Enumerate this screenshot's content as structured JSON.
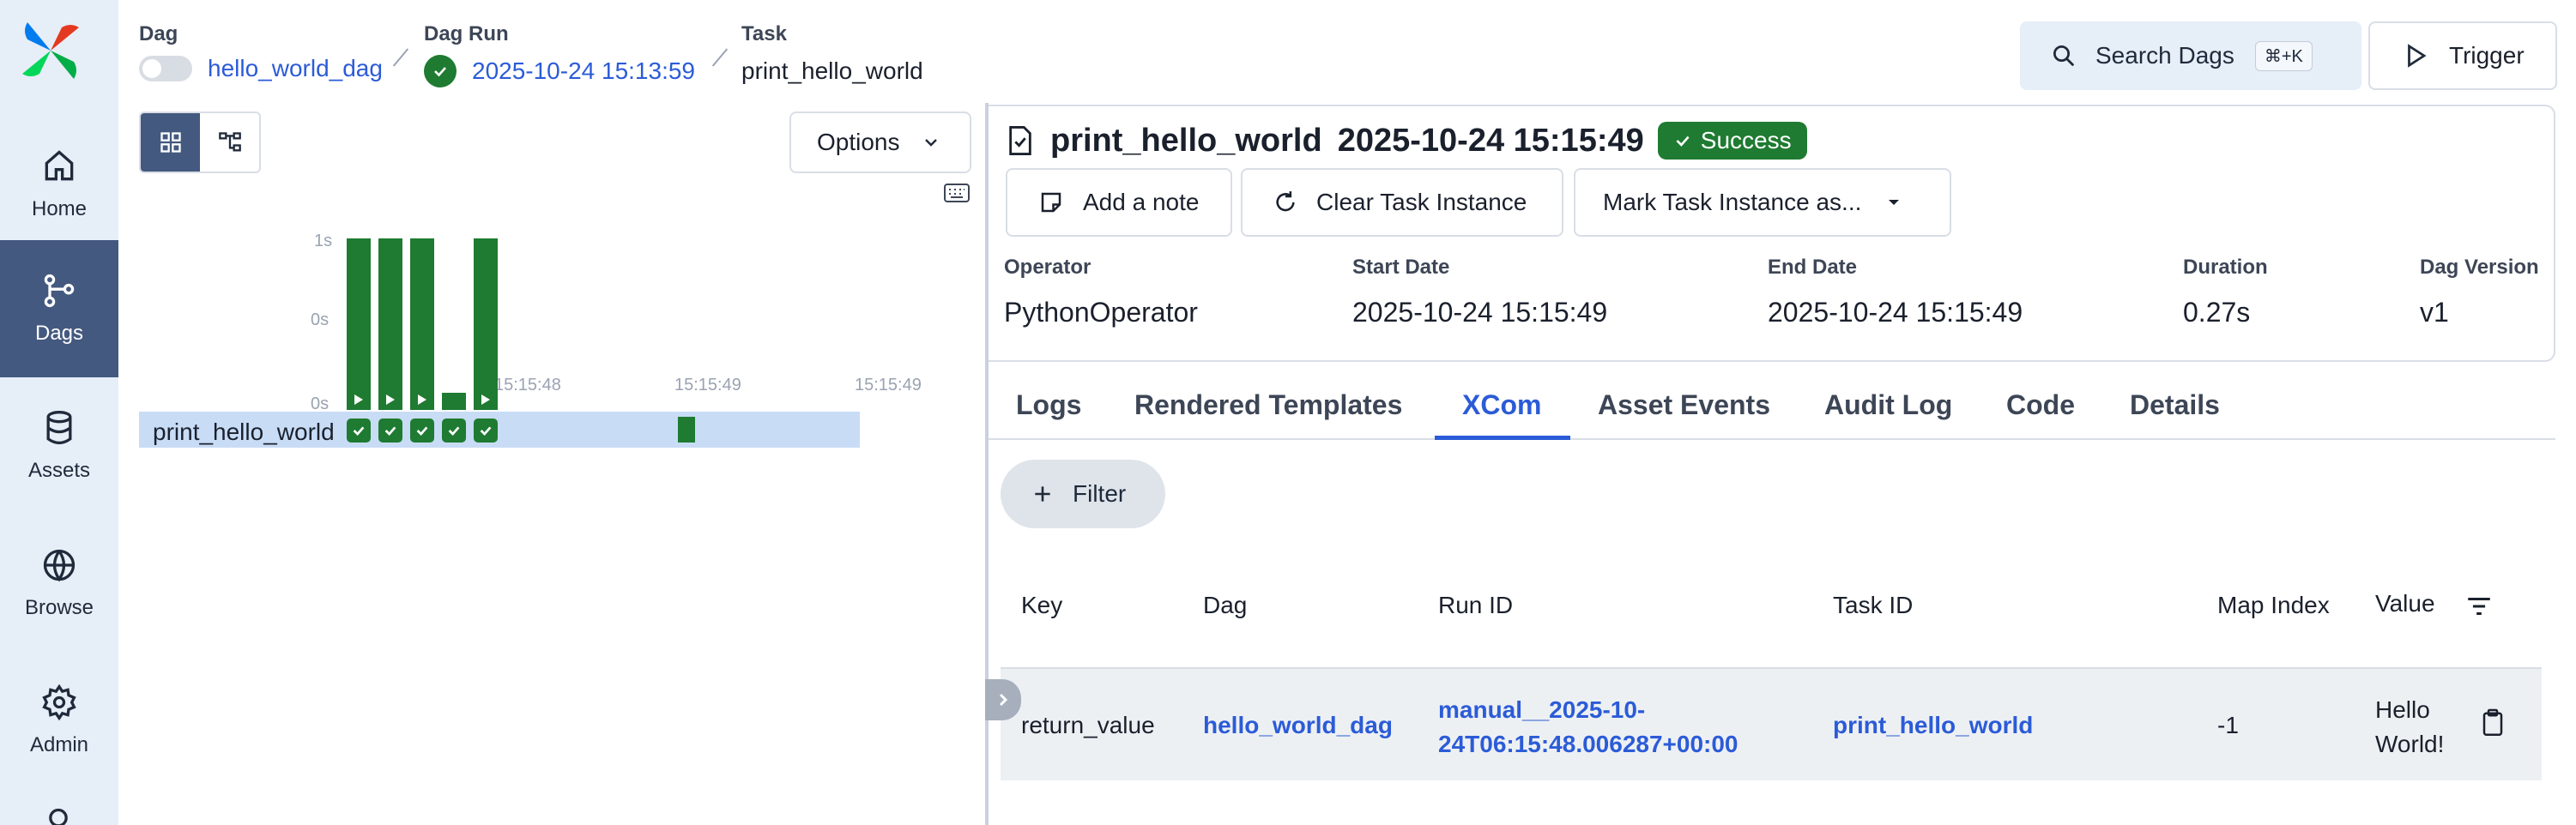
{
  "nav": {
    "items": [
      {
        "label": "Home",
        "icon": "home-icon"
      },
      {
        "label": "Dags",
        "icon": "dags-icon"
      },
      {
        "label": "Assets",
        "icon": "database-icon"
      },
      {
        "label": "Browse",
        "icon": "globe-icon"
      },
      {
        "label": "Admin",
        "icon": "gear-icon"
      }
    ],
    "active": "Dags"
  },
  "breadcrumb": {
    "dag_label": "Dag",
    "dag_value": "hello_world_dag",
    "run_label": "Dag Run",
    "run_value": "2025-10-24 15:13:59",
    "task_label": "Task",
    "task_value": "print_hello_world"
  },
  "header": {
    "search_label": "Search Dags",
    "search_shortcut": "⌘+K",
    "trigger_label": "Trigger"
  },
  "grid": {
    "options_label": "Options",
    "y_ticks": [
      "1s",
      "0s",
      "0s"
    ],
    "x_ticks": [
      "15:15:48",
      "15:15:49",
      "15:15:49"
    ],
    "task_name": "print_hello_world",
    "run_durations": [
      1.0,
      1.0,
      1.0,
      0.1,
      1.0
    ],
    "colors": {
      "success": "#1e7b31",
      "selected_row": "#c8dcf6"
    }
  },
  "task_instance": {
    "title": "print_hello_world",
    "timestamp": "2025-10-24 15:15:49",
    "state": "Success",
    "actions": {
      "add_note": "Add a note",
      "clear": "Clear Task Instance",
      "mark": "Mark Task Instance as..."
    },
    "details": [
      {
        "label": "Operator",
        "value": "PythonOperator"
      },
      {
        "label": "Start Date",
        "value": "2025-10-24 15:15:49"
      },
      {
        "label": "End Date",
        "value": "2025-10-24 15:15:49"
      },
      {
        "label": "Duration",
        "value": "0.27s"
      },
      {
        "label": "Dag Version",
        "value": "v1"
      }
    ]
  },
  "tabs": {
    "items": [
      "Logs",
      "Rendered Templates",
      "XCom",
      "Asset Events",
      "Audit Log",
      "Code",
      "Details"
    ],
    "active": "XCom"
  },
  "xcom": {
    "filter_label": "Filter",
    "columns": [
      "Key",
      "Dag",
      "Run ID",
      "Task ID",
      "Map Index",
      "Value"
    ],
    "rows": [
      {
        "key": "return_value",
        "dag": "hello_world_dag",
        "run_id_line1": "manual__2025-10-",
        "run_id_line2": "24T06:15:48.006287+00:00",
        "task_id": "print_hello_world",
        "map_index": "-1",
        "value_line1": "Hello",
        "value_line2": "World!"
      }
    ]
  }
}
